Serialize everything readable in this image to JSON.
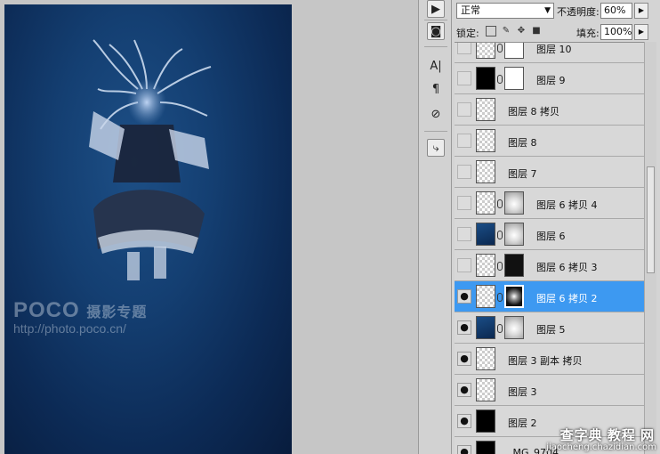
{
  "canvas": {
    "watermark_brand": "POCO",
    "watermark_title": "摄影专题",
    "watermark_url": "http://photo.poco.cn/"
  },
  "panel": {
    "blend_mode": "正常",
    "opacity_label": "不透明度:",
    "opacity_value": "60%",
    "lock_label": "锁定:",
    "fill_label": "填充:",
    "fill_value": "100%"
  },
  "layers": [
    {
      "name": "图层 10",
      "visible": false,
      "selected": false,
      "thumb": "transparent",
      "mask": "white"
    },
    {
      "name": "图层 9",
      "visible": false,
      "selected": false,
      "thumb": "black",
      "mask": "white"
    },
    {
      "name": "图层 8 拷贝",
      "visible": false,
      "selected": false,
      "thumb": "transparent",
      "mask": null
    },
    {
      "name": "图层 8",
      "visible": false,
      "selected": false,
      "thumb": "transparent",
      "mask": null
    },
    {
      "name": "图层 7",
      "visible": false,
      "selected": false,
      "thumb": "transparent",
      "mask": null
    },
    {
      "name": "图层 6 拷贝 4",
      "visible": false,
      "selected": false,
      "thumb": "transparent",
      "mask": "soft"
    },
    {
      "name": "图层 6",
      "visible": false,
      "selected": false,
      "thumb": "blue",
      "mask": "soft"
    },
    {
      "name": "图层 6 拷贝 3",
      "visible": false,
      "selected": false,
      "thumb": "transparent",
      "mask": "figure"
    },
    {
      "name": "图层 6 拷贝 2",
      "visible": true,
      "selected": true,
      "thumb": "transparent",
      "mask": "dark"
    },
    {
      "name": "图层 5",
      "visible": true,
      "selected": false,
      "thumb": "blue",
      "mask": "soft"
    },
    {
      "name": "图层 3 副本 拷贝",
      "visible": true,
      "selected": false,
      "thumb": "transparent",
      "mask": null
    },
    {
      "name": "图层 3",
      "visible": true,
      "selected": false,
      "thumb": "transparent",
      "mask": null
    },
    {
      "name": "图层 2",
      "visible": true,
      "selected": false,
      "thumb": "black",
      "mask": null
    },
    {
      "name": "_MG_9704",
      "visible": true,
      "selected": false,
      "thumb": "photo",
      "mask": null
    }
  ],
  "site_watermark": {
    "line1": "查字典 教程 网",
    "line2": "jiaocheng.chazidian.com"
  },
  "icons": [
    "play-icon",
    "layers-icon",
    "character-icon",
    "paragraph-icon",
    "circle-slash-icon",
    "layer-comps-icon",
    "lock-transparency-icon",
    "brush-lock-icon",
    "move-lock-icon",
    "lock-all-icon",
    "eye-icon",
    "link-chain-icon"
  ],
  "colors": {
    "selection": "#3d99f1",
    "canvas_bg": "#c6c6c6",
    "panel_bg": "#d4d4d4"
  }
}
